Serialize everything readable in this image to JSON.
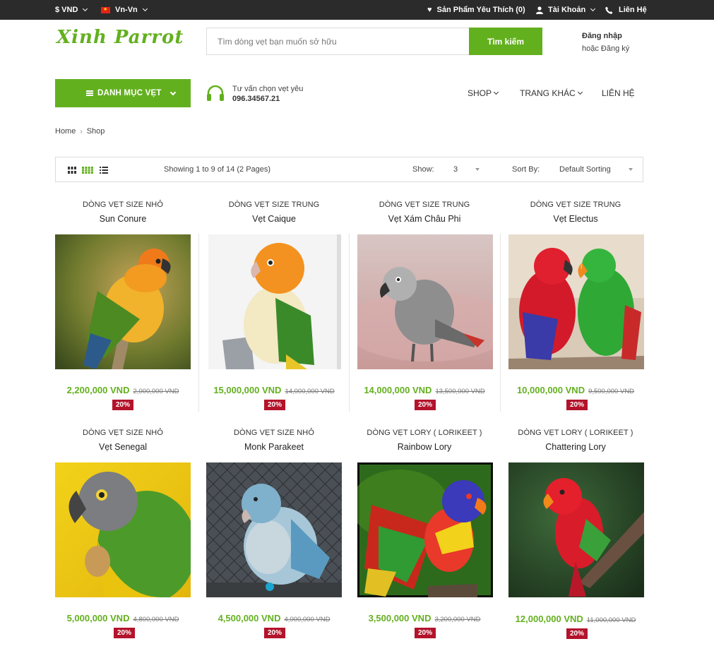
{
  "topbar": {
    "currency": "$ VND",
    "language": "Vn-Vn",
    "wishlist": "Sản Phẩm Yêu Thích (0)",
    "account": "Tài Khoản",
    "contact": "Liên Hệ"
  },
  "header": {
    "logo": "Xinh Parrot",
    "search": {
      "placeholder": "Tìm dòng vẹt bạn muốn sở hữu",
      "button": "Tìm kiếm"
    },
    "login": "Đăng nhập",
    "register": "hoặc Đăng ký"
  },
  "nav": {
    "category_button": "DANH MỤC VẸT",
    "support_label": "Tư vấn chọn vẹt yêu",
    "support_phone": "096.34567.21",
    "items": [
      {
        "label": "SHOP",
        "has_dropdown": true
      },
      {
        "label": "TRANG KHÁC",
        "has_dropdown": true
      },
      {
        "label": "LIÊN HỆ",
        "has_dropdown": false
      }
    ]
  },
  "breadcrumb": [
    "Home",
    "Shop"
  ],
  "toolbar": {
    "showing": "Showing 1 to 9 of 14 (2 Pages)",
    "show_label": "Show:",
    "show_value": "3",
    "sort_label": "Sort By:",
    "sort_value": "Default Sorting"
  },
  "products": [
    {
      "category": "DÒNG VẸT SIZE NHỎ",
      "name": "Sun Conure",
      "price": "2,200,000 VND",
      "old_price": "2,000,000 VND",
      "discount": "20%"
    },
    {
      "category": "DÒNG VẸT SIZE TRUNG",
      "name": "Vẹt Caique",
      "price": "15,000,000 VND",
      "old_price": "14,000,000 VND",
      "discount": "20%"
    },
    {
      "category": "DÒNG VẸT SIZE TRUNG",
      "name": "Vẹt Xám Châu Phi",
      "price": "14,000,000 VND",
      "old_price": "13,500,000 VND",
      "discount": "20%"
    },
    {
      "category": "DÒNG VẸT SIZE TRUNG",
      "name": "Vẹt Electus",
      "price": "10,000,000 VND",
      "old_price": "9,500,000 VND",
      "discount": "20%"
    },
    {
      "category": "DÒNG VẸT SIZE NHỎ",
      "name": "Vẹt Senegal",
      "price": "5,000,000 VND",
      "old_price": "4,800,000 VND",
      "discount": "20%"
    },
    {
      "category": "DÒNG VẸT SIZE NHỎ",
      "name": "Monk Parakeet",
      "price": "4,500,000 VND",
      "old_price": "4,000,000 VND",
      "discount": "20%"
    },
    {
      "category": "DÒNG VẸT LORY ( LORIKEET )",
      "name": "Rainbow Lory",
      "price": "3,500,000 VND",
      "old_price": "3,200,000 VND",
      "discount": "20%"
    },
    {
      "category": "DÒNG VẸT LORY ( LORIKEET )",
      "name": "Chattering Lory",
      "price": "12,000,000 VND",
      "old_price": "11,000,000 VND",
      "discount": "20%"
    }
  ],
  "colors": {
    "accent": "#63b01f",
    "topbar": "#2b2b2b",
    "badge": "#b3132b"
  }
}
